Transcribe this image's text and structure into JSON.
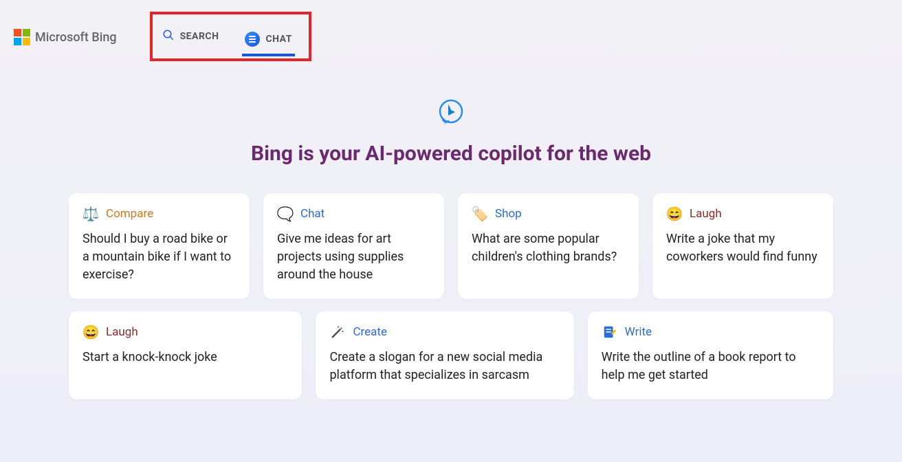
{
  "header": {
    "brand": "Microsoft Bing",
    "nav": {
      "search": "SEARCH",
      "chat": "CHAT"
    }
  },
  "hero": {
    "headline": "Bing is your AI-powered copilot for the web"
  },
  "cards": {
    "row1": [
      {
        "title": "Compare",
        "body": "Should I buy a road bike or a mountain bike if I want to exercise?"
      },
      {
        "title": "Chat",
        "body": "Give me ideas for art projects using supplies around the house"
      },
      {
        "title": "Shop",
        "body": "What are some popular children's clothing brands?"
      },
      {
        "title": "Laugh",
        "body": "Write a joke that my coworkers would find funny"
      }
    ],
    "row2": [
      {
        "title": "Laugh",
        "body": "Start a knock-knock joke"
      },
      {
        "title": "Create",
        "body": "Create a slogan for a new social media platform that specializes in sarcasm"
      },
      {
        "title": "Write",
        "body": "Write the outline of a book report to help me get started"
      }
    ]
  }
}
